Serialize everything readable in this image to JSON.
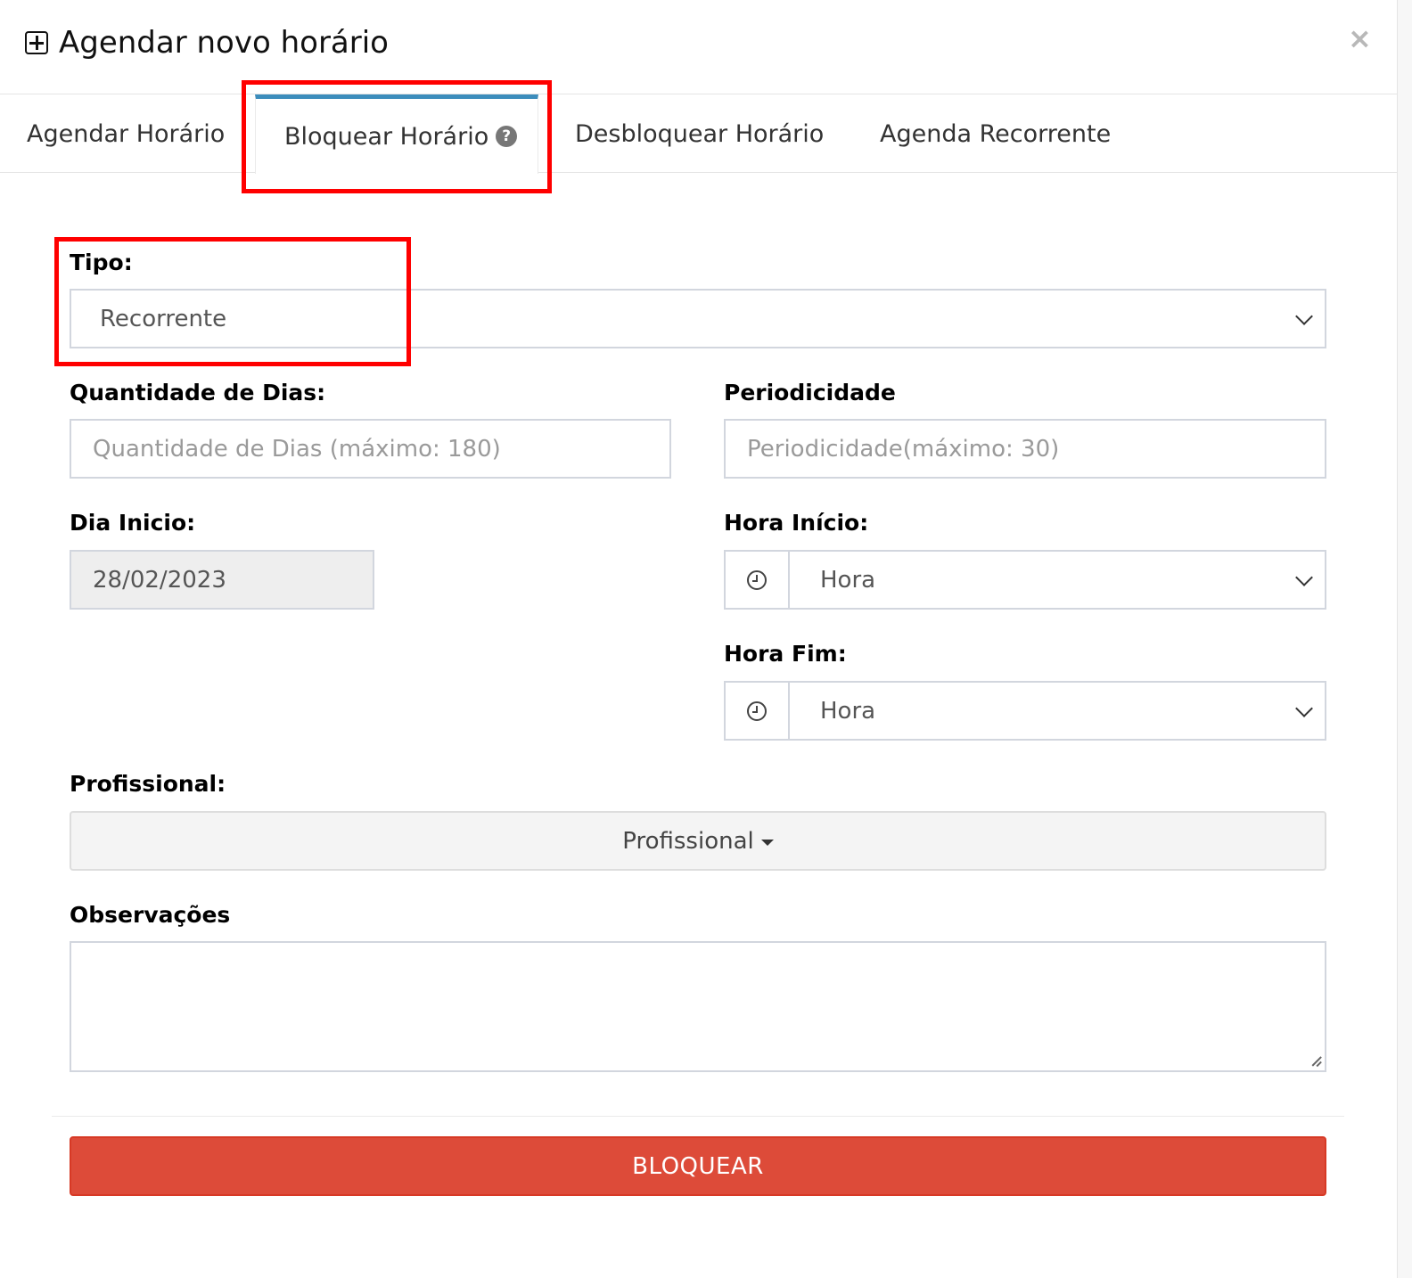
{
  "modal": {
    "title": "Agendar novo horário",
    "close_label": "×"
  },
  "tabs": [
    {
      "label": "Agendar Horário",
      "active": false
    },
    {
      "label": "Bloquear Horário",
      "active": true,
      "help_icon": "question-circle-icon"
    },
    {
      "label": "Desbloquear Horário",
      "active": false
    },
    {
      "label": "Agenda Recorrente",
      "active": false
    }
  ],
  "form": {
    "tipo": {
      "label": "Tipo:",
      "value": "Recorrente"
    },
    "quantidade": {
      "label": "Quantidade de Dias:",
      "placeholder": "Quantidade de Dias (máximo: 180)"
    },
    "periodicidade": {
      "label": "Periodicidade",
      "placeholder": "Periodicidade(máximo: 30)"
    },
    "dia_inicio": {
      "label": "Dia Inicio:",
      "value": "28/02/2023"
    },
    "hora_inicio": {
      "label": "Hora Início:",
      "value": "Hora"
    },
    "hora_fim": {
      "label": "Hora Fim:",
      "value": "Hora"
    },
    "profissional": {
      "label": "Profissional:",
      "button_label": "Profissional"
    },
    "observacoes": {
      "label": "Observações"
    },
    "submit_label": "BLOQUEAR"
  },
  "colors": {
    "tab_active_border": "#3c8dbc",
    "submit_bg": "#dd4b39",
    "highlight": "#ff0000"
  }
}
